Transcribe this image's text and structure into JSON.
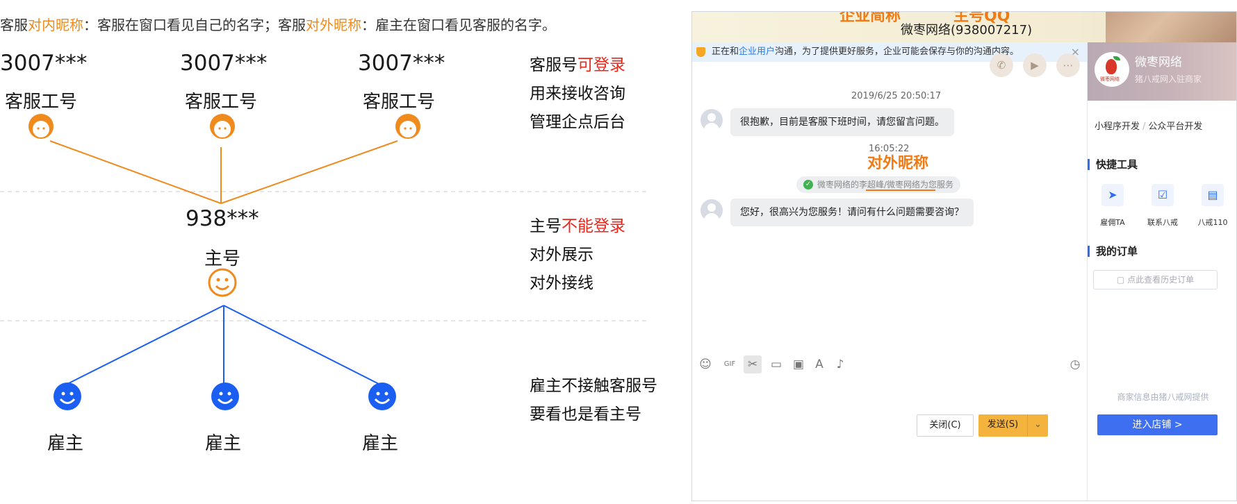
{
  "diagram": {
    "caption": {
      "p1": "客服",
      "p2": "对内昵称",
      "p3": "：客服在窗口看见自己的名字；客服",
      "p4": "对外昵称",
      "p5": "：雇主在窗口看见客服的名字。"
    },
    "service_accounts": [
      {
        "id": "3007***",
        "label": "客服工号"
      },
      {
        "id": "3007***",
        "label": "客服工号"
      },
      {
        "id": "3007***",
        "label": "客服工号"
      }
    ],
    "main_account": {
      "id": "938***",
      "label": "主号"
    },
    "employers": [
      "雇主",
      "雇主",
      "雇主"
    ],
    "notes": {
      "service": {
        "l1a": "客服号",
        "l1b": "可登录",
        "l2": "用来接收咨询",
        "l3": "管理企点后台"
      },
      "main": {
        "l1a": "主号",
        "l1b": "不能登录",
        "l2": "对外展示",
        "l3": "对外接线"
      },
      "employer": {
        "l1": "雇主不接触客服号",
        "l2": "要看也是看主号"
      }
    },
    "colors": {
      "orange": "#f08a1c",
      "blue": "#1a5ff2",
      "red": "#e8281c"
    }
  },
  "chat": {
    "title": "微枣网络(938007217)",
    "annotations": {
      "company_short": "企业简称",
      "main_qq": "主号QQ",
      "external_nick": "对外昵称"
    },
    "notice": {
      "a": "正在和",
      "b": "企业用户",
      "c": "沟通，为了提供更好服务，企业可能会保存与你的沟通内容。",
      "close": "×"
    },
    "messages": [
      {
        "time": "2019/6/25 20:50:17",
        "text": "很抱歉，目前是客服下班时间，请您留言问题。"
      },
      {
        "time": "16:05:22",
        "system": "微枣网络的李超峰/微枣网络为您服务"
      },
      {
        "text": "您好，很高兴为您服务！请问有什么问题需要咨询？"
      }
    ],
    "buttons": {
      "close": "关闭(C)",
      "send": "发送(S)",
      "send_dropdown": "⌄"
    }
  },
  "side": {
    "shop_name": "微枣网络",
    "shop_sub": "猪八戒网入驻商家",
    "logo_text": "微枣网络",
    "tags": [
      "小程序开发",
      "公众平台开发"
    ],
    "tag_sep": "/",
    "quick_tools_title": "快捷工具",
    "quick_tools": [
      {
        "icon": "send-icon",
        "label": "雇佣TA"
      },
      {
        "icon": "check-icon",
        "label": "联系八戒"
      },
      {
        "icon": "contact-card-icon",
        "label": "八戒110"
      }
    ],
    "orders_title": "我的订单",
    "history_btn": "点此查看历史订单",
    "provider": "商家信息由猪八戒网提供",
    "enter_btn": "进入店铺 >"
  }
}
